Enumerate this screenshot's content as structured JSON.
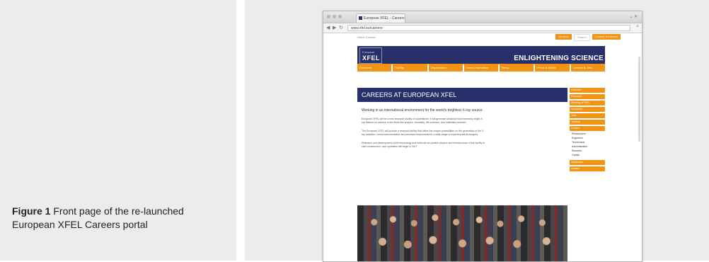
{
  "caption": {
    "label": "Figure 1",
    "text": " Front page of the re-launched European XFEL Careers portal"
  },
  "browser": {
    "tab_title": "European XFEL - Careers",
    "url": "www.xfel.eu/careers",
    "window_controls": "⌄ ✕"
  },
  "site": {
    "top_left": "Home  Contact",
    "top_buttons": [
      "Deutsch",
      "Search",
      "Contact & Intranet"
    ],
    "logo_small": "European",
    "logo_main": "XFEL",
    "tagline": "ENLIGHTENING SCIENCE",
    "main_nav": [
      "Research",
      "Facility",
      "Organization",
      "Users Information",
      "News",
      "Press & Media",
      "Careers & Jobs"
    ],
    "content_title": "CAREERS AT EUROPEAN XFEL",
    "intro": "Working in an international environment for the world's brightest X-ray source",
    "paragraphs": [
      "European XFEL will be a new research facility of superlatives: It will generate ultrashort and extremely bright X-ray flashes for science in the fields like physics, chemistry, life sciences, and materials research.",
      "The European XFEL will provide a research facility that offers the unique possibilities for the generation of the X-ray radiation, novel instrumentation and precision instruments for a wide range of experimental techniques.",
      "Research and development of the technology and methods for particle physics and infrastructure of the facility to start construction, user operation will begin in 2017."
    ],
    "side_nav": [
      "Overview",
      "Research",
      "Working at XFEL",
      "Vacancies",
      "Jobs",
      "Training",
      "Contact"
    ],
    "side_sub": [
      "Researchers",
      "Engineers",
      "Technicians",
      "Administration",
      "Students",
      "Guests"
    ],
    "side_nav_bottom": [
      "Application",
      "Contact"
    ]
  }
}
